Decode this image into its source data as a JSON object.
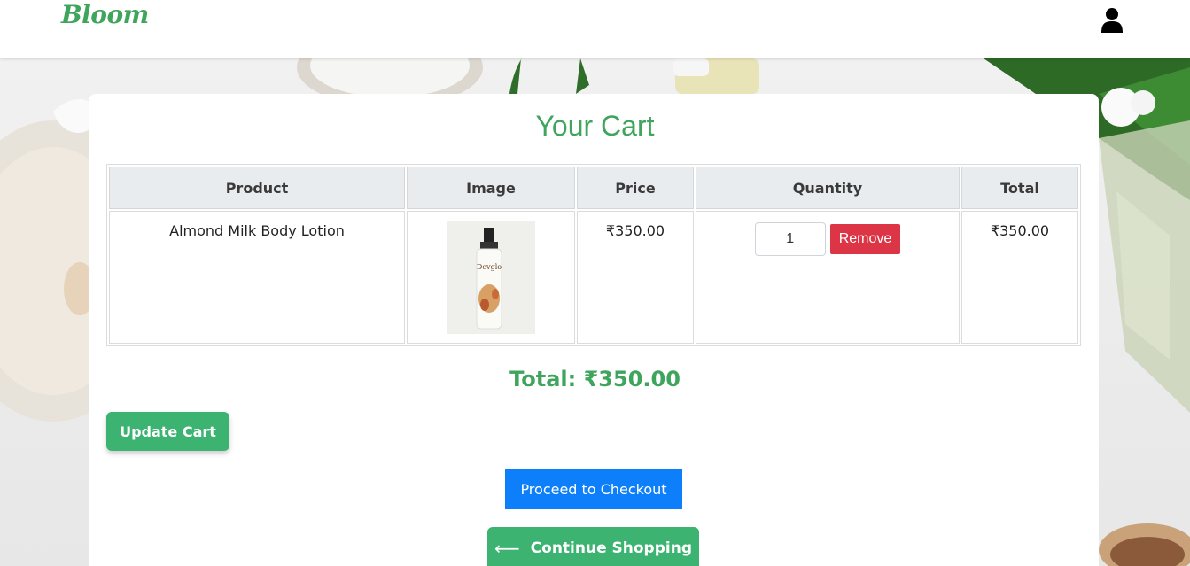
{
  "navbar": {
    "brand": "Bloom",
    "user_icon": "user-icon"
  },
  "cart": {
    "title": "Your Cart",
    "columns": [
      "Product",
      "Image",
      "Price",
      "Quantity",
      "Total"
    ],
    "items": [
      {
        "product": "Almond Milk Body Lotion",
        "image_icon": "lotion-bottle-image",
        "price": "₹350.00",
        "quantity": "1",
        "remove_label": "Remove",
        "total": "₹350.00"
      }
    ],
    "grand_total": "Total: ₹350.00"
  },
  "actions": {
    "update_label": "Update Cart",
    "checkout_label": "Proceed to Checkout",
    "continue_label": "Continue Shopping",
    "continue_icon": "arrow-left-icon"
  },
  "colors": {
    "brand_green": "#3fa45c",
    "button_green": "#3cb371",
    "checkout_blue": "#0d7ffb",
    "remove_red": "#dc3545"
  }
}
